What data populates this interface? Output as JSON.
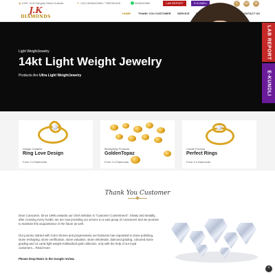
{
  "topbar": {
    "address": "129C, B.B.Ganguly Street Kolkata",
    "phone": "+(91) 9836442689 / 7980381928",
    "whatsapp": "9836442689",
    "lab_report_label": "LAB REPORT",
    "ekundli_label": "E-KUNDLI",
    "social": [
      "f",
      "G+",
      "in"
    ]
  },
  "logo": {
    "text_main": "J.K",
    "text_sub": "DIAMONDS"
  },
  "nav": {
    "items": [
      {
        "label": "HOME",
        "active": true
      },
      {
        "label": "THANK YOU CUSTOMER",
        "active": false
      },
      {
        "label": "SERVICE",
        "active": false
      },
      {
        "label": "PRODUCTS",
        "active": false
      },
      {
        "label": "GALLERY",
        "active": false
      },
      {
        "label": "CONTACT US",
        "active": false
      }
    ]
  },
  "hero": {
    "subtitle": "Light WeightJewelry",
    "title": "14kt Light Weight Jewelry",
    "tagline_prefix": "Products Are ",
    "tagline_bold": "Ultra Light WeightJewelry",
    "slide_count": 2,
    "active_slide": 1
  },
  "side_tabs": {
    "lab_report": "LAB REPORT",
    "ekundli": "E-KUNDLI"
  },
  "products": [
    {
      "small": "Design Creative",
      "title": "Ring Love Design",
      "from": "From 2.4 Diamonds"
    },
    {
      "small": "Bestselling Products",
      "title": "GoldenTopaz",
      "from": "From 2.4 Diamonds"
    },
    {
      "small": "Create Product",
      "title": "Perfect Rings",
      "from": "From 2.4 Diamonds"
    }
  ],
  "about": {
    "heading": "Thank You Customer",
    "para1": "Dear Consumer, Since 1995 onwards our chief ambition is \"Customer Contentment\". Slowly and steadily, after crossing every hurdle; we are now providing our service to a vast group of consumers and we promise to maintain this acquaintance in the future as well.",
    "para2": "Our journey started with Color Stones and progressively our business has expanded to stone polishing, stone reshaping, stone certification, stone valuation, stone wholesale, diamond grading, coloured stone grading and 14 carat light weight Hallmarked gold collection, only with the help of our loyal customers....Read more",
    "cta": "Please Drop Rator in the Google review."
  },
  "scroll_top_icon": "^"
}
